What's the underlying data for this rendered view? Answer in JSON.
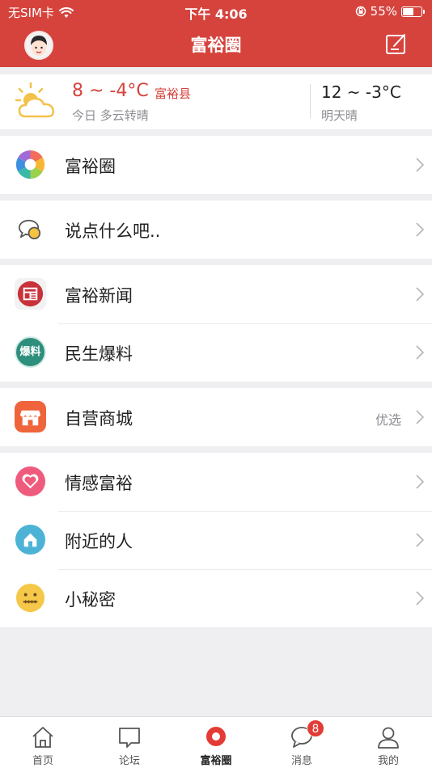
{
  "status_bar": {
    "carrier": "无SIM卡",
    "time": "下午 4:06",
    "battery": "55%"
  },
  "header": {
    "title": "富裕圈"
  },
  "weather": {
    "today_temp": "8 ~ -4°C",
    "county": "富裕县",
    "today_desc": "今日  多云转晴",
    "tomorrow_temp": "12 ~ -3°C",
    "tomorrow_desc": "明天晴"
  },
  "sections": [
    {
      "items": [
        {
          "label": "富裕圈",
          "icon": "aperture-icon"
        }
      ]
    },
    {
      "items": [
        {
          "label": "说点什么吧..",
          "icon": "chat-bubbles-icon"
        }
      ]
    },
    {
      "items": [
        {
          "label": "富裕新闻",
          "icon": "newspaper-icon"
        },
        {
          "label": "民生爆料",
          "icon": "baoliao-icon",
          "icon_text": "爆料"
        }
      ]
    },
    {
      "items": [
        {
          "label": "自营商城",
          "icon": "store-icon",
          "extra": "优选"
        }
      ]
    },
    {
      "items": [
        {
          "label": "情感富裕",
          "icon": "heart-icon"
        },
        {
          "label": "附近的人",
          "icon": "house-icon"
        },
        {
          "label": "小秘密",
          "icon": "zipped-face-icon"
        }
      ]
    }
  ],
  "tabbar": {
    "tabs": [
      {
        "label": "首页",
        "icon": "home-icon"
      },
      {
        "label": "论坛",
        "icon": "forum-icon"
      },
      {
        "label": "富裕圈",
        "icon": "circle-icon",
        "active": true
      },
      {
        "label": "消息",
        "icon": "message-icon",
        "badge": "8"
      },
      {
        "label": "我的",
        "icon": "profile-icon"
      }
    ]
  },
  "colors": {
    "brand_red": "#d6433d",
    "badge_red": "#e33b35"
  }
}
